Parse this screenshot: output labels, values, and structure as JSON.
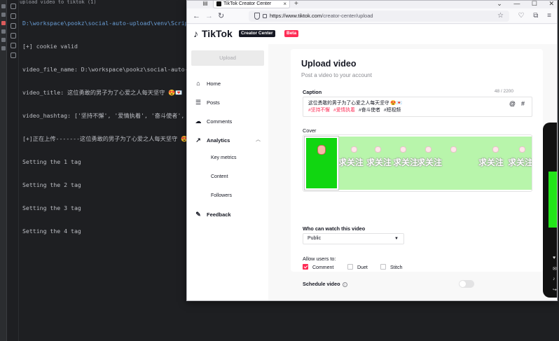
{
  "ide": {
    "tab_label": "upload_video_to_tiktok (1)",
    "console_lines": [
      "D:\\workspace\\pookz\\social-auto-upload\\venv\\Scripts\\python.exe",
      "[+] cookie valid",
      "video_file_name: D:\\workspace\\pookz\\social-auto-upload",
      "video_title: 这位勇敢的男子为了心爱之人每天坚守 😍💌",
      "video_hashtag: ['坚持不懈', '爱情执着', '奋斗使者', '短视频",
      "[+]正在上传-------这位勇敢的男子为了心爱之人每天坚守 😍💌.mp4",
      "Setting the 1 tag",
      "Setting the 2 tag",
      "Setting the 3 tag",
      "Setting the 4 tag"
    ]
  },
  "browser": {
    "tab_title": "TikTok Creator Center",
    "url_host": "https://www.tiktok.com",
    "url_path": "/creator-center/upload",
    "tab_close": "×",
    "new_tab": "+",
    "win_min": "—",
    "win_max": "☐",
    "win_close": "✕",
    "back": "←",
    "forward": "→",
    "reload": "↻",
    "star": "☆",
    "tool_icons": [
      "pocket-icon",
      "extensions-icon",
      "menu-icon"
    ]
  },
  "tiktok": {
    "logo_text": "TikTok",
    "creator_center_badge": "Creator Center",
    "beta_badge": "Beta",
    "upload_button": "Upload",
    "nav": {
      "home": "Home",
      "posts": "Posts",
      "comments": "Comments",
      "analytics": "Analytics",
      "key_metrics": "Key metrics",
      "content": "Content",
      "followers": "Followers",
      "feedback": "Feedback"
    },
    "form": {
      "title": "Upload video",
      "subtitle": "Post a video to your account",
      "caption_label": "Caption",
      "caption_count": "48 / 2200",
      "caption_text": "这位勇敢的男子为了心爱之人每天坚守 😍💌",
      "caption_tags": [
        "#坚持不懈",
        "#爱情执着",
        "#奋斗使者",
        "#短视频"
      ],
      "caption_mention": "@",
      "caption_hash": "#",
      "cover_label": "Cover",
      "cover_frame_text": "求关注",
      "privacy_label": "Who can watch this video",
      "privacy_value": "Public",
      "allow_label": "Allow users to:",
      "allow_comment": "Comment",
      "allow_duet": "Duet",
      "allow_stitch": "Stitch",
      "comment_checked": true,
      "duet_checked": false,
      "stitch_checked": false,
      "schedule_label": "Schedule video",
      "schedule_on": false
    },
    "colors": {
      "brand_red": "#fe2c55",
      "cover_green": "#11d611"
    }
  }
}
